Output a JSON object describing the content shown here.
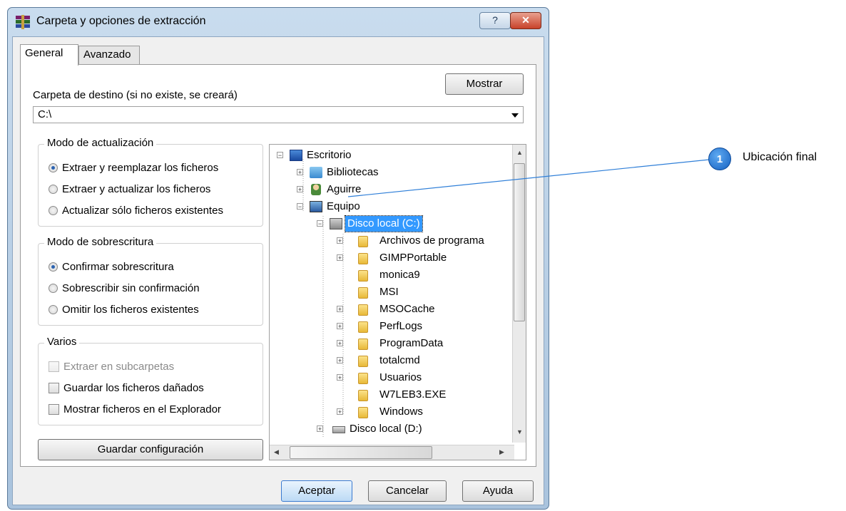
{
  "window": {
    "title": "Carpeta y opciones de extracción",
    "help_label": "?",
    "close_label": "✕"
  },
  "tabs": [
    {
      "label": "General"
    },
    {
      "label": "Avanzado"
    }
  ],
  "destination": {
    "label": "Carpeta de destino (si no existe, se creará)",
    "value": "C:\\",
    "show_button": "Mostrar"
  },
  "update_mode": {
    "title": "Modo de actualización",
    "options": [
      {
        "label": "Extraer y reemplazar los ficheros",
        "selected": true
      },
      {
        "label": "Extraer y actualizar los ficheros",
        "selected": false
      },
      {
        "label": "Actualizar sólo ficheros existentes",
        "selected": false
      }
    ]
  },
  "overwrite_mode": {
    "title": "Modo de sobrescritura",
    "options": [
      {
        "label": "Confirmar sobrescritura",
        "selected": true
      },
      {
        "label": "Sobrescribir sin confirmación",
        "selected": false
      },
      {
        "label": "Omitir los ficheros existentes",
        "selected": false
      }
    ]
  },
  "misc": {
    "title": "Varios",
    "options": [
      {
        "label": "Extraer en subcarpetas",
        "checked": false,
        "disabled": true
      },
      {
        "label": "Guardar los ficheros dañados",
        "checked": false,
        "disabled": false
      },
      {
        "label": "Mostrar ficheros en el Explorador",
        "checked": false,
        "disabled": false
      }
    ]
  },
  "save_config_button": "Guardar configuración",
  "tree": {
    "items": [
      {
        "label": "Escritorio",
        "icon": "desktop-icon"
      },
      {
        "label": "Bibliotecas",
        "icon": "libraries-icon"
      },
      {
        "label": "Aguirre",
        "icon": "user-icon"
      },
      {
        "label": "Equipo",
        "icon": "computer-icon"
      },
      {
        "label": "Disco local (C:)",
        "icon": "drive-icon",
        "selected": true
      },
      {
        "label": "Archivos de programa",
        "icon": "folder-icon"
      },
      {
        "label": "GIMPPortable",
        "icon": "folder-icon"
      },
      {
        "label": "monica9",
        "icon": "folder-icon"
      },
      {
        "label": "MSI",
        "icon": "folder-icon"
      },
      {
        "label": "MSOCache",
        "icon": "folder-icon"
      },
      {
        "label": "PerfLogs",
        "icon": "folder-icon"
      },
      {
        "label": "ProgramData",
        "icon": "folder-icon"
      },
      {
        "label": "totalcmd",
        "icon": "folder-icon"
      },
      {
        "label": "Usuarios",
        "icon": "folder-icon"
      },
      {
        "label": "W7LEB3.EXE",
        "icon": "folder-icon"
      },
      {
        "label": "Windows",
        "icon": "folder-icon"
      },
      {
        "label": "Disco local (D:)",
        "icon": "drive-icon"
      }
    ]
  },
  "buttons": {
    "ok": "Aceptar",
    "cancel": "Cancelar",
    "help": "Ayuda"
  },
  "callout": {
    "number": "1",
    "text": "Ubicación final",
    "color": "#2f7fd8"
  }
}
